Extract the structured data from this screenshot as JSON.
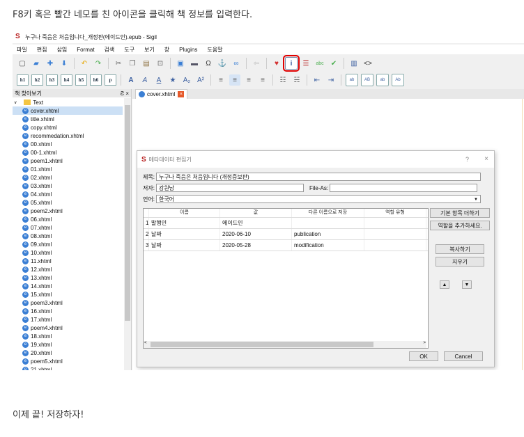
{
  "captions": {
    "top": "F8키 혹은 빨간 네모를 친 아이콘을 클릭해 책 정보를 입력한다.",
    "bottom": "이제 끝! 저장하자!"
  },
  "window": {
    "title": "누구나 죽음은 처음입니다_개정판(에이드인).epub - Sigil"
  },
  "menu": [
    "파일",
    "편집",
    "삽입",
    "Format",
    "검색",
    "도구",
    "보기",
    "창",
    "Plugins",
    "도움말"
  ],
  "toolbar2": {
    "headings": [
      "h1",
      "h2",
      "h3",
      "h4",
      "h5",
      "h6",
      "p"
    ]
  },
  "panel": {
    "title": "책 찾아보기",
    "pin": "Ƨ ×",
    "folder": "Text",
    "files": [
      "cover.xhtml",
      "title.xhtml",
      "copy.xhtml",
      "recommedation.xhtml",
      "00.xhtml",
      "00-1.xhtml",
      "poem1.xhtml",
      "01.xhtml",
      "02.xhtml",
      "03.xhtml",
      "04.xhtml",
      "05.xhtml",
      "poem2.xhtml",
      "06.xhtml",
      "07.xhtml",
      "08.xhtml",
      "09.xhtml",
      "10.xhtml",
      "11.xhtml",
      "12.xhtml",
      "13.xhtml",
      "14.xhtml",
      "15.xhtml",
      "poem3.xhtml",
      "16.xhtml",
      "17.xhtml",
      "poem4.xhtml",
      "18.xhtml",
      "19.xhtml",
      "20.xhtml",
      "poem5.xhtml",
      "21.xhtml"
    ]
  },
  "editor": {
    "tab": "cover.xhtml"
  },
  "dialog": {
    "title": "메타데이터 편집기",
    "help": "?",
    "close": "×",
    "title_label": "제목:",
    "title_value": "누구나 죽음은 처음입니다 (개정증보판)",
    "author_label": "저자:",
    "author_value": "강원남",
    "fileas_label": "File-As:",
    "fileas_value": "",
    "lang_label": "언어:",
    "lang_value": "한국어",
    "columns": [
      "이름",
      "값",
      "다른 이름으로 저장",
      "역할 유형"
    ],
    "rows": [
      {
        "n": "1",
        "name": "발행인",
        "value": "에이드인",
        "save": "",
        "role": ""
      },
      {
        "n": "2",
        "name": "날짜",
        "value": "2020-06-10",
        "save": "publication",
        "role": ""
      },
      {
        "n": "3",
        "name": "날짜",
        "value": "2020-05-28",
        "save": "modification",
        "role": ""
      }
    ],
    "btn_add_basic": "기본 항목 더하기",
    "btn_add_role": "역할을 추가하세요.",
    "btn_copy": "복사하기",
    "btn_delete": "지우기",
    "btn_ok": "OK",
    "btn_cancel": "Cancel"
  }
}
